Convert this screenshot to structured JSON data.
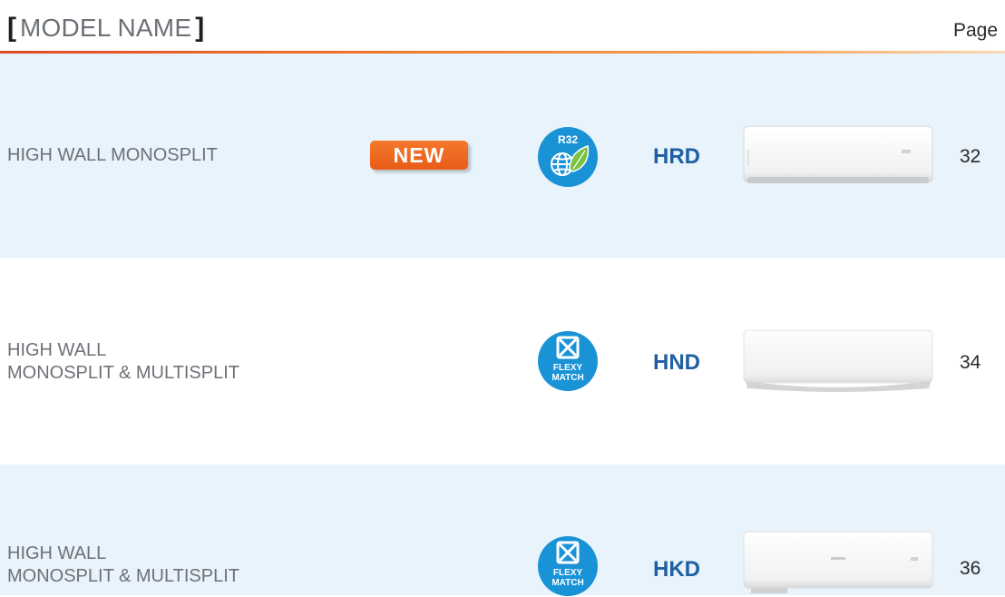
{
  "header": {
    "bracket_open": "[",
    "title": "MODEL NAME",
    "bracket_close": "]",
    "page_label": "Page"
  },
  "rows": [
    {
      "category_lines": [
        "HIGH WALL MONOSPLIT"
      ],
      "new_label": "NEW",
      "badge": {
        "icon": "r32-refrigerant-leaf-globe-icon",
        "text": "R32"
      },
      "model": "HRD",
      "page": "32"
    },
    {
      "category_lines": [
        "HIGH WALL",
        "MONOSPLIT & MULTISPLIT"
      ],
      "badge": {
        "icon": "flexy-match-icon",
        "line1": "FLEXY",
        "line2": "MATCH"
      },
      "model": "HND",
      "page": "34"
    },
    {
      "category_lines": [
        "HIGH WALL",
        "MONOSPLIT & MULTISPLIT"
      ],
      "badge": {
        "icon": "flexy-match-icon",
        "line1": "FLEXY",
        "line2": "MATCH"
      },
      "model": "HKD",
      "page": "36"
    }
  ],
  "colors": {
    "accent_blue": "#1f5fa2",
    "badge_blue": "#1a93d6",
    "new_orange": "#ec6620",
    "row_shade": "#e8f3fb",
    "rule_orange": "#e14b2a"
  }
}
